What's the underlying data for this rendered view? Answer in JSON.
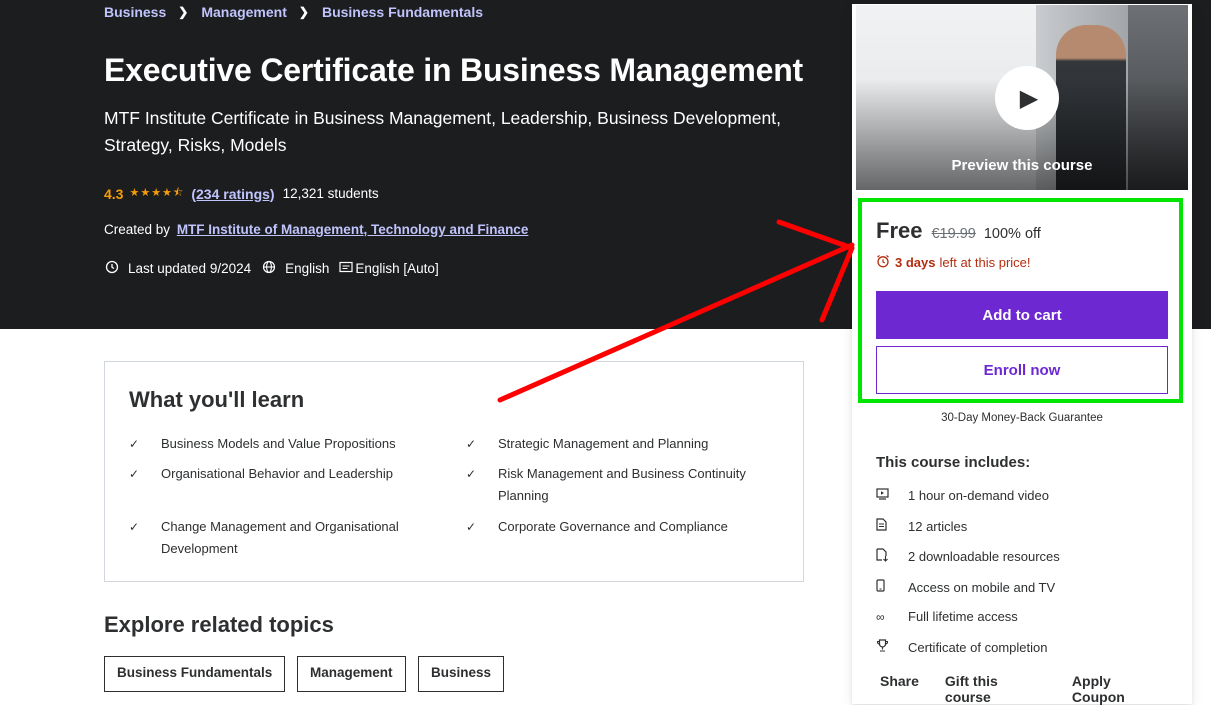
{
  "breadcrumb": [
    "Business",
    "Management",
    "Business Fundamentals"
  ],
  "course": {
    "title": "Executive Certificate in Business Management",
    "subtitle": "MTF Institute Certificate in Business Management, Leadership, Business Development, Strategy, Risks, Models",
    "rating": "4.3",
    "stars": "★★★★⯪",
    "ratings_count": "(234 ratings)",
    "students": "12,321 students",
    "created_by_label": "Created by",
    "creator": "MTF Institute of Management, Technology and Finance",
    "last_updated": "Last updated 9/2024",
    "language": "English",
    "captions": "English [Auto]"
  },
  "learn": {
    "title": "What you'll learn",
    "items": [
      "Business Models and Value Propositions",
      "Strategic Management and Planning",
      "Organisational Behavior and Leadership",
      "Risk Management and Business Continuity Planning",
      "Change Management and Organisational Development",
      "Corporate Governance and Compliance"
    ]
  },
  "explore": {
    "title": "Explore related topics",
    "topics": [
      "Business Fundamentals",
      "Management",
      "Business"
    ]
  },
  "sidebar": {
    "preview_label": "Preview this course",
    "price": "Free",
    "original_price": "€19.99",
    "discount": "100% off",
    "countdown_days": "3 days",
    "countdown_rest": "left at this price!",
    "add_to_cart": "Add to cart",
    "enroll_now": "Enroll now",
    "guarantee": "30-Day Money-Back Guarantee",
    "includes_title": "This course includes:",
    "includes": [
      {
        "icon": "video-icon",
        "label": "1 hour on-demand video"
      },
      {
        "icon": "article-icon",
        "label": "12 articles"
      },
      {
        "icon": "download-icon",
        "label": "2 downloadable resources"
      },
      {
        "icon": "mobile-icon",
        "label": "Access on mobile and TV"
      },
      {
        "icon": "infinity-icon",
        "label": "Full lifetime access"
      },
      {
        "icon": "trophy-icon",
        "label": "Certificate of completion"
      }
    ],
    "footer": [
      "Share",
      "Gift this course",
      "Apply Coupon"
    ]
  },
  "colors": {
    "hero_bg": "#1c1d1f",
    "link_purple": "#c0c4fc",
    "star_orange": "#f69c08",
    "brand_purple": "#6d28d2",
    "alert_red": "#b32d0f",
    "highlight_green": "#00e600",
    "annotation_red": "#ff0000"
  }
}
